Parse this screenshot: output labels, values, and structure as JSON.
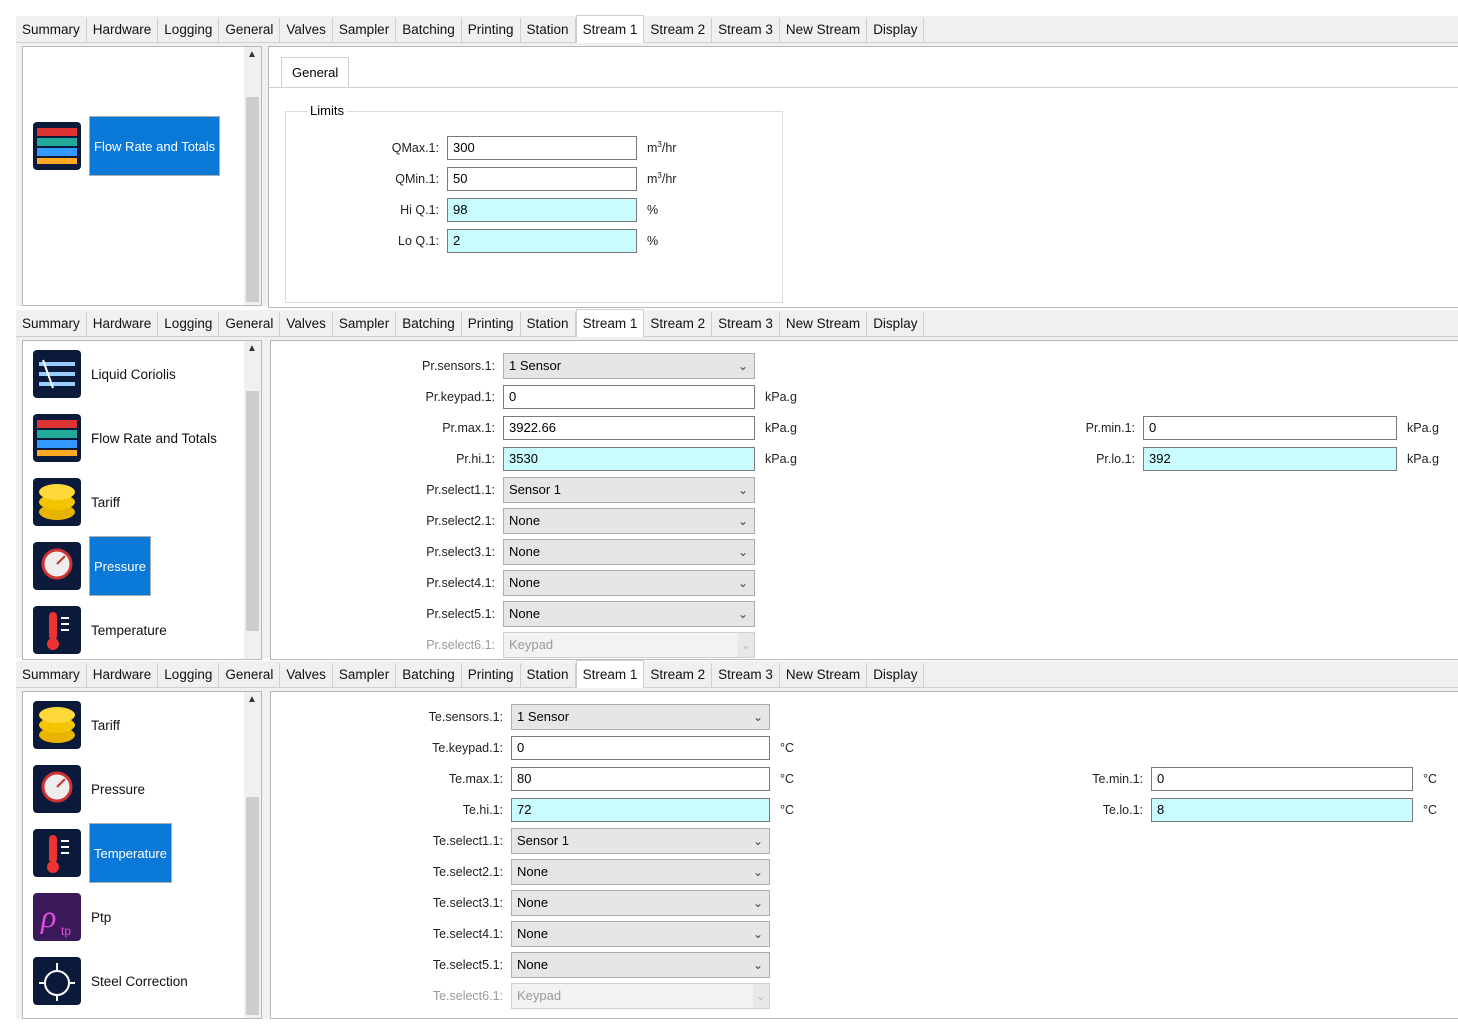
{
  "tabs": [
    "Summary",
    "Hardware",
    "Logging",
    "General",
    "Valves",
    "Sampler",
    "Batching",
    "Printing",
    "Station",
    "Stream 1",
    "Stream 2",
    "Stream 3",
    "New Stream",
    "Display"
  ],
  "active_tab": "Stream 1",
  "panel1": {
    "nav": [
      {
        "label": "Flow Rate and Totals",
        "selected": true,
        "icon": "flow-rate-icon"
      }
    ],
    "subtab": "General",
    "group": "Limits",
    "fields": [
      {
        "label": "QMax.1:",
        "value": "300",
        "unit": "m3/hr",
        "highlight": false
      },
      {
        "label": "QMin.1:",
        "value": "50",
        "unit": "m3/hr",
        "highlight": false
      },
      {
        "label": "Hi Q.1:",
        "value": "98",
        "unit": "%",
        "highlight": true
      },
      {
        "label": "Lo Q.1:",
        "value": "2",
        "unit": "%",
        "highlight": true
      }
    ],
    "unit_base": "m",
    "unit_sup": "3",
    "unit_tail": "/hr"
  },
  "panel2": {
    "nav": [
      {
        "label": "Liquid Coriolis",
        "selected": false,
        "icon": "coriolis-icon"
      },
      {
        "label": "Flow Rate and Totals",
        "selected": false,
        "icon": "flow-rate-icon"
      },
      {
        "label": "Tariff",
        "selected": false,
        "icon": "tariff-coins-icon"
      },
      {
        "label": "Pressure",
        "selected": true,
        "icon": "pressure-gauge-icon"
      },
      {
        "label": "Temperature",
        "selected": false,
        "icon": "thermometer-icon"
      }
    ],
    "sensors": {
      "label": "Pr.sensors.1:",
      "value": "1 Sensor"
    },
    "keypad": {
      "label": "Pr.keypad.1:",
      "value": "0",
      "unit": "kPa.g"
    },
    "max": {
      "label": "Pr.max.1:",
      "value": "3922.66",
      "unit": "kPa.g"
    },
    "hi": {
      "label": "Pr.hi.1:",
      "value": "3530",
      "unit": "kPa.g"
    },
    "min": {
      "label": "Pr.min.1:",
      "value": "0",
      "unit": "kPa.g"
    },
    "lo": {
      "label": "Pr.lo.1:",
      "value": "392",
      "unit": "kPa.g"
    },
    "selects": [
      {
        "label": "Pr.select1.1:",
        "value": "Sensor 1",
        "disabled": false
      },
      {
        "label": "Pr.select2.1:",
        "value": "None",
        "disabled": false
      },
      {
        "label": "Pr.select3.1:",
        "value": "None",
        "disabled": false
      },
      {
        "label": "Pr.select4.1:",
        "value": "None",
        "disabled": false
      },
      {
        "label": "Pr.select5.1:",
        "value": "None",
        "disabled": false
      },
      {
        "label": "Pr.select6.1:",
        "value": "Keypad",
        "disabled": true
      }
    ]
  },
  "panel3": {
    "nav": [
      {
        "label": "Tariff",
        "selected": false,
        "icon": "tariff-coins-icon"
      },
      {
        "label": "Pressure",
        "selected": false,
        "icon": "pressure-gauge-icon"
      },
      {
        "label": "Temperature",
        "selected": true,
        "icon": "thermometer-icon"
      },
      {
        "label": "Ptp",
        "selected": false,
        "icon": "rho-tp-icon"
      },
      {
        "label": "Steel Correction",
        "selected": false,
        "icon": "steel-correction-icon"
      }
    ],
    "sensors": {
      "label": "Te.sensors.1:",
      "value": "1 Sensor"
    },
    "keypad": {
      "label": "Te.keypad.1:",
      "value": "0",
      "unit": "°C"
    },
    "max": {
      "label": "Te.max.1:",
      "value": "80",
      "unit": "°C"
    },
    "hi": {
      "label": "Te.hi.1:",
      "value": "72",
      "unit": "°C"
    },
    "min": {
      "label": "Te.min.1:",
      "value": "0",
      "unit": "°C"
    },
    "lo": {
      "label": "Te.lo.1:",
      "value": "8",
      "unit": "°C"
    },
    "selects": [
      {
        "label": "Te.select1.1:",
        "value": "Sensor 1",
        "disabled": false
      },
      {
        "label": "Te.select2.1:",
        "value": "None",
        "disabled": false
      },
      {
        "label": "Te.select3.1:",
        "value": "None",
        "disabled": false
      },
      {
        "label": "Te.select4.1:",
        "value": "None",
        "disabled": false
      },
      {
        "label": "Te.select5.1:",
        "value": "None",
        "disabled": false
      },
      {
        "label": "Te.select6.1:",
        "value": "Keypad",
        "disabled": true
      }
    ]
  }
}
